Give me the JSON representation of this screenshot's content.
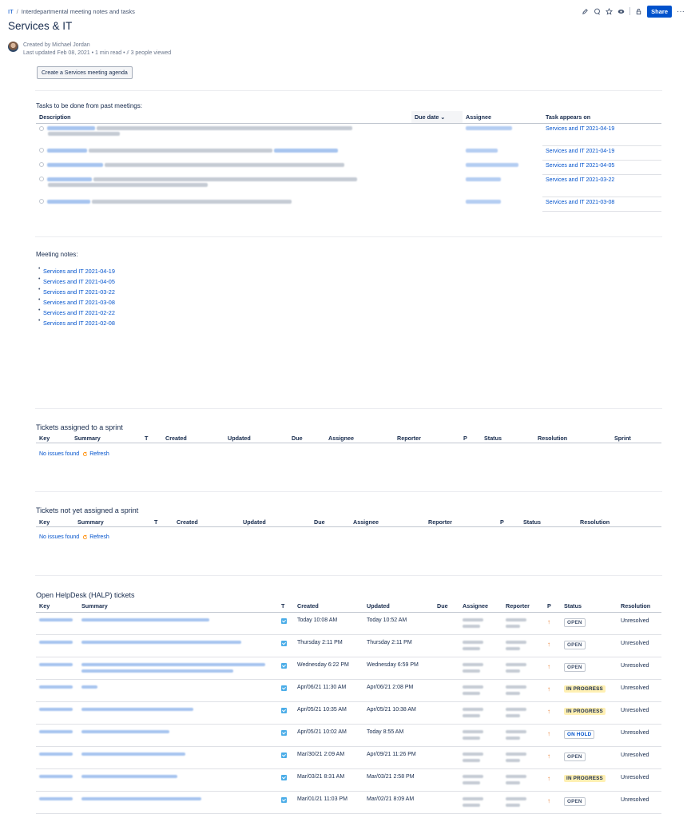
{
  "breadcrumb": {
    "space": "IT",
    "page": "Interdepartmental meeting notes and tasks"
  },
  "share_label": "Share",
  "more_label": "···",
  "title": "Services & IT",
  "byline": {
    "created_by": "Created by Michael Jordan",
    "last_updated": "Last updated Feb 08, 2021",
    "read_time": "1 min read",
    "viewers": "3 people viewed"
  },
  "create_button": "Create a Services meeting agenda",
  "tasks": {
    "heading": "Tasks to be done from past meetings:",
    "columns": {
      "description": "Description",
      "due": "Due date ⌄",
      "assignee": "Assignee",
      "appears": "Task appears on"
    },
    "rows": [
      {
        "appears_on": "Services and IT 2021-04-19"
      },
      {
        "appears_on": "Services and IT 2021-04-19"
      },
      {
        "appears_on": "Services and IT 2021-04-05"
      },
      {
        "appears_on": "Services and IT 2021-03-22"
      },
      {
        "appears_on": "Services and IT 2021-03-08"
      }
    ]
  },
  "meeting_notes": {
    "heading": "Meeting notes:",
    "items": [
      "Services and IT 2021-04-19",
      "Services and IT 2021-04-05",
      "Services and IT 2021-03-22",
      "Services and IT 2021-03-08",
      "Services and IT 2021-02-22",
      "Services and IT 2021-02-08"
    ]
  },
  "sprint_assigned": {
    "heading": "Tickets assigned to a sprint",
    "columns": [
      "Key",
      "Summary",
      "T",
      "Created",
      "Updated",
      "Due",
      "Assignee",
      "Reporter",
      "P",
      "Status",
      "Resolution",
      "Sprint"
    ],
    "empty": "No issues found",
    "refresh": "Refresh"
  },
  "sprint_unassigned": {
    "heading": "Tickets not yet assigned a sprint",
    "columns": [
      "Key",
      "Summary",
      "T",
      "Created",
      "Updated",
      "Due",
      "Assignee",
      "Reporter",
      "P",
      "Status",
      "Resolution"
    ],
    "empty": "No issues found",
    "refresh": "Refresh"
  },
  "halp": {
    "heading": "Open HelpDesk (HALP) tickets",
    "columns": [
      "Key",
      "Summary",
      "T",
      "Created",
      "Updated",
      "Due",
      "Assignee",
      "Reporter",
      "P",
      "Status",
      "Resolution"
    ],
    "rows": [
      {
        "created": "Today 10:08 AM",
        "updated": "Today 10:52 AM",
        "status": "OPEN",
        "status_kind": "open",
        "resolution": "Unresolved"
      },
      {
        "created": "Thursday 2:11 PM",
        "updated": "Thursday 2:11 PM",
        "status": "OPEN",
        "status_kind": "open",
        "resolution": "Unresolved"
      },
      {
        "created": "Wednesday 6:22 PM",
        "updated": "Wednesday 6:59 PM",
        "status": "OPEN",
        "status_kind": "open",
        "resolution": "Unresolved"
      },
      {
        "created": "Apr/06/21 11:30 AM",
        "updated": "Apr/06/21 2:08 PM",
        "status": "IN PROGRESS",
        "status_kind": "progress",
        "resolution": "Unresolved"
      },
      {
        "created": "Apr/05/21 10:35 AM",
        "updated": "Apr/05/21 10:38 AM",
        "status": "IN PROGRESS",
        "status_kind": "progress",
        "resolution": "Unresolved"
      },
      {
        "created": "Apr/05/21 10:02 AM",
        "updated": "Today 8:55 AM",
        "status": "ON HOLD",
        "status_kind": "hold",
        "resolution": "Unresolved"
      },
      {
        "created": "Mar/30/21 2:09 AM",
        "updated": "Apr/09/21 11:26 PM",
        "status": "OPEN",
        "status_kind": "open",
        "resolution": "Unresolved"
      },
      {
        "created": "Mar/03/21 8:31 AM",
        "updated": "Mar/03/21 2:58 PM",
        "status": "IN PROGRESS",
        "status_kind": "progress",
        "resolution": "Unresolved"
      },
      {
        "created": "Mar/01/21 11:03 PM",
        "updated": "Mar/02/21 8:09 AM",
        "status": "OPEN",
        "status_kind": "open",
        "resolution": "Unresolved"
      }
    ],
    "priority_glyph": "↑"
  },
  "icons": [
    "edit-icon",
    "comment-icon",
    "star-icon",
    "watch-icon",
    "restrictions-icon"
  ],
  "colors": {
    "accent": "#0052cc",
    "progress_bg": "#fff0b3",
    "priority": "#e97f33",
    "task_icon": "#4bade8"
  }
}
